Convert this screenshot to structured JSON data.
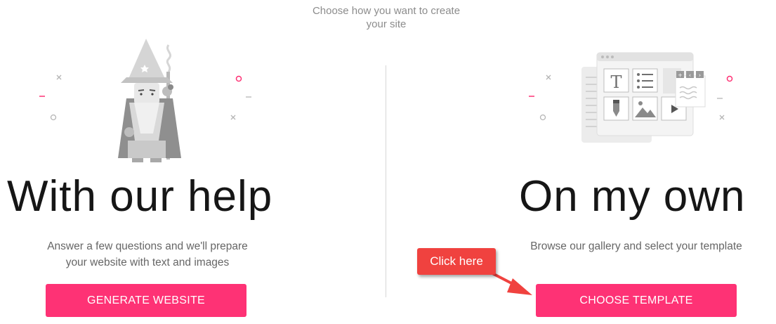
{
  "header": {
    "line1": "Choose how you want to create",
    "line2": "your site"
  },
  "left": {
    "title": "With our help",
    "description_line1": "Answer a few questions and we'll prepare",
    "description_line2": "your website with text and images",
    "button_label": "GENERATE WEBSITE"
  },
  "right": {
    "title": "On my own",
    "description": "Browse our gallery and select your template",
    "button_label": "CHOOSE TEMPLATE"
  },
  "annotation": {
    "callout_text": "Click here"
  },
  "colors": {
    "accent": "#fe3275",
    "callout": "#f0423f",
    "muted_text": "#8c8c8c",
    "illustration_gray": "#c8c8c8"
  },
  "icons": [
    "wizard-illustration",
    "template-editor-illustration",
    "text-tool-icon",
    "list-tool-icon",
    "pen-tool-icon",
    "image-tool-icon",
    "video-tool-icon"
  ]
}
